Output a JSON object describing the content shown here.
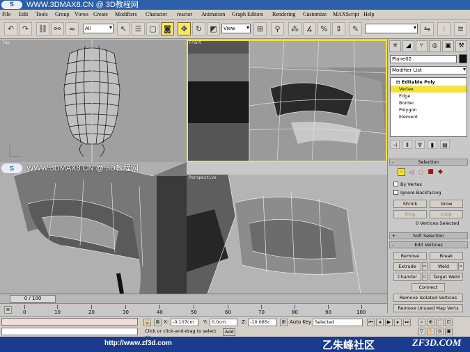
{
  "banner": {
    "logo": "S",
    "text": "WWW.3DMAX8.CN @ 3D教程网"
  },
  "menu": [
    "File",
    "Edit",
    "Tools",
    "Group",
    "Views",
    "Create",
    "Modifiers",
    "Character",
    "reactor",
    "Animation",
    "Graph Editors",
    "Rendering",
    "Customize",
    "MAXScript",
    "Help"
  ],
  "toolbar": {
    "selection_filter": "All",
    "ref_coord": "View",
    "named_selection": ""
  },
  "viewports": {
    "top_left": "Top",
    "top_right": "Front",
    "bottom_left": "",
    "bottom_right": "Perspective"
  },
  "watermark": {
    "logo": "S",
    "text": "WWW.3DMAX8.CN @ 3D教程网"
  },
  "command_panel": {
    "object_name": "Plane02",
    "modifier_list": "Modifier List",
    "stack": {
      "title": "Editable Poly",
      "items": [
        "Vertex",
        "Edge",
        "Border",
        "Polygon",
        "Element"
      ]
    },
    "selection_rollout": "Selection",
    "by_vertex": "By Vertex",
    "ignore_backfacing": "Ignore Backfacing",
    "shrink": "Shrink",
    "grow": "Grow",
    "ring": "Ring",
    "loop": "Loop",
    "selection_status": "0 Vertices Selected",
    "soft_selection": "Soft Selection",
    "edit_vertices": "Edit Vertices",
    "remove": "Remove",
    "break": "Break",
    "extrude": "Extrude",
    "weld": "Weld",
    "chamfer": "Chamfer",
    "target_weld": "Target Weld",
    "connect": "Connect",
    "remove_isolated": "Remove Isolated Vertices",
    "remove_unused_map": "Remove Unused Map Verts"
  },
  "timeline": {
    "frame_display": "0 / 100",
    "ticks": [
      "0",
      "10",
      "20",
      "30",
      "40",
      "50",
      "60",
      "70",
      "80",
      "90",
      "100"
    ]
  },
  "status": {
    "x_label": "X:",
    "x_value": "-0.107cm",
    "y_label": "Y:",
    "y_value": "0.0cm",
    "z_label": "Z:",
    "z_value": "-10.085c",
    "prompt": "Click or click-and-drag to select ob",
    "add_label": "Add",
    "auto_key": "Auto Key",
    "key_mode": "Selected"
  },
  "footer": {
    "url": "http://www.zf3d.com",
    "brand": "乙朱峰社区",
    "site": "ZF3D.COM"
  },
  "colors": {
    "banner": "#2b5fa8",
    "footer": "#1a3b8e",
    "active_viewport": "#f2e23a",
    "stack_selection": "#f5e23a"
  }
}
